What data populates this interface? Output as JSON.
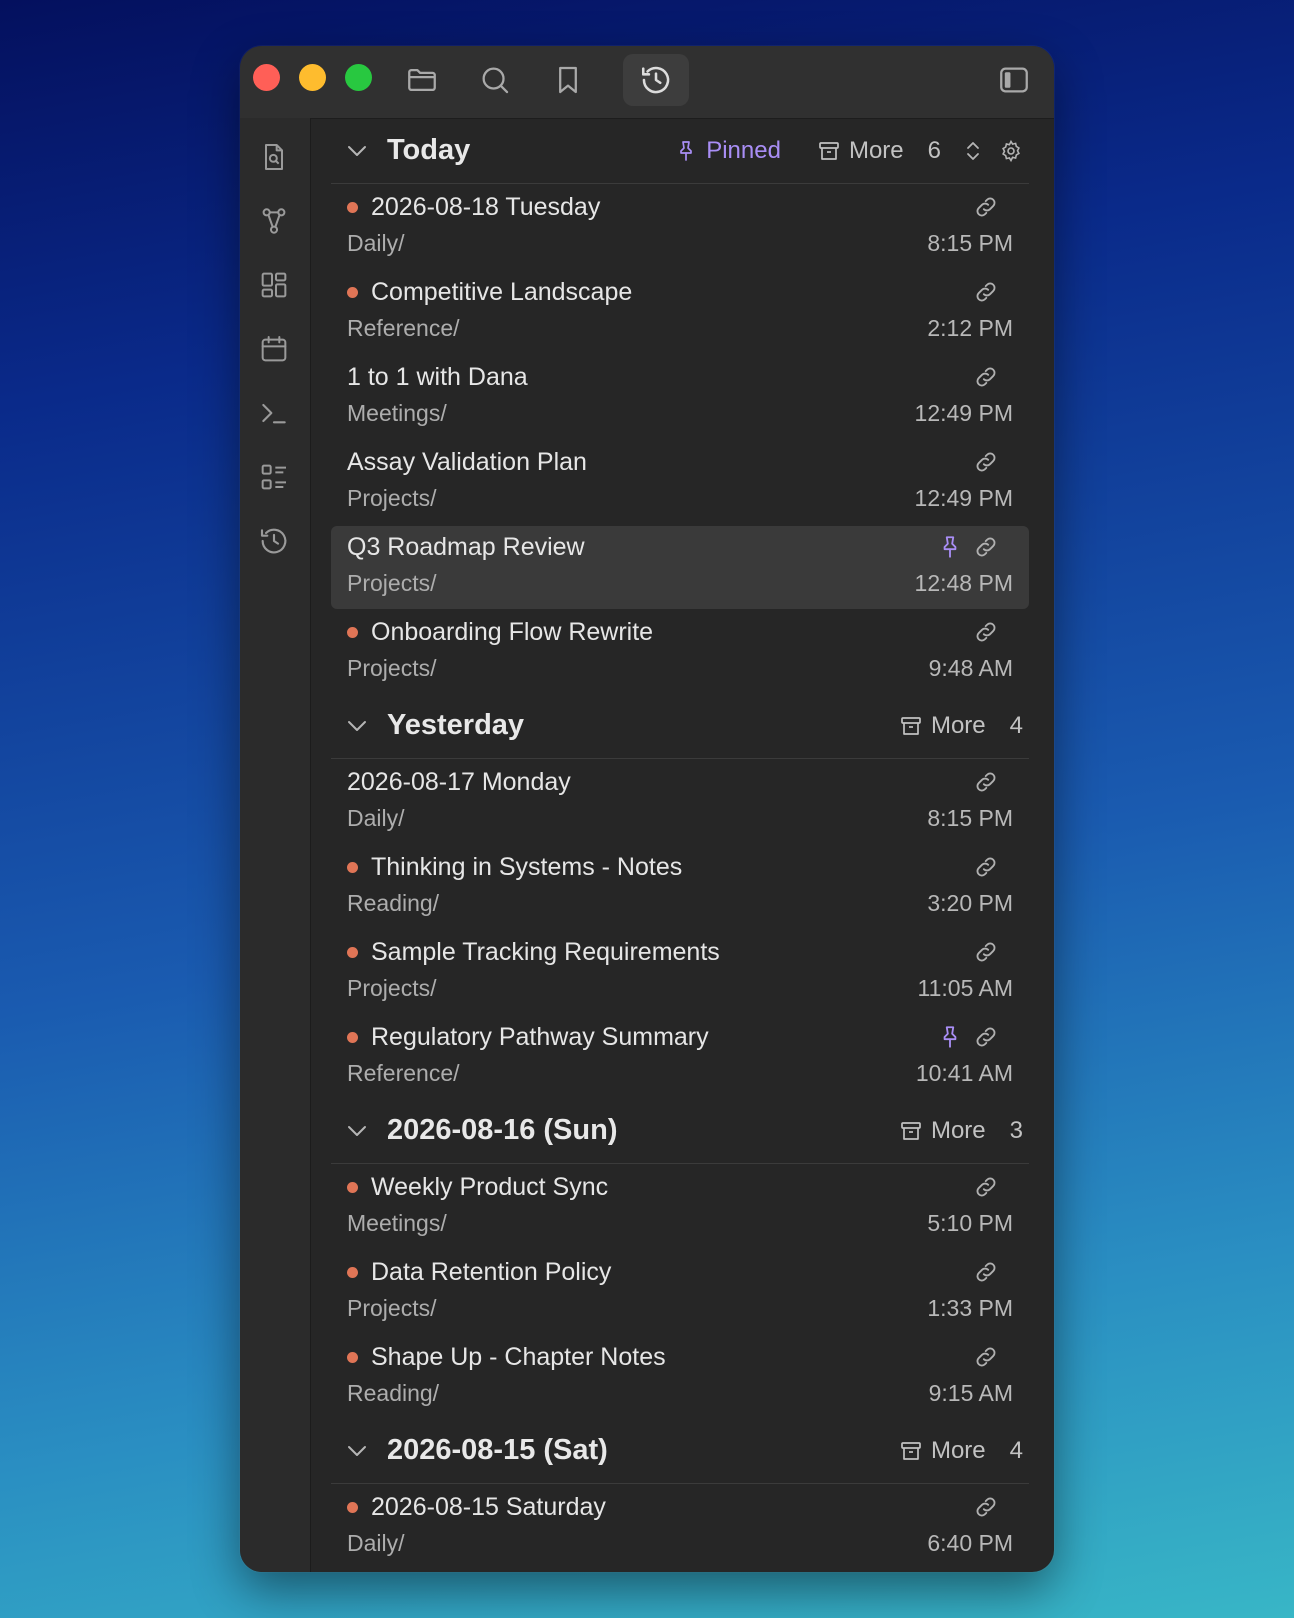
{
  "colors": {
    "accent_purple": "#a98ef5",
    "dot_orange": "#e07556",
    "traffic_red": "#ff5f57",
    "traffic_yellow": "#febc2e",
    "traffic_green": "#28c840"
  },
  "toolbar": {
    "icons": [
      "folder-icon",
      "search-icon",
      "bookmark-icon",
      "history-icon",
      "sidebar-toggle-icon"
    ],
    "active": "history-icon"
  },
  "ribbon": {
    "icons": [
      "file-search-icon",
      "graph-icon",
      "dashboard-icon",
      "calendar-icon",
      "terminal-icon",
      "checklist-icon",
      "history-icon"
    ]
  },
  "sections": [
    {
      "title": "Today",
      "pinned_label": "Pinned",
      "more_label": "More",
      "count": "6",
      "items": [
        {
          "title": "2026-08-18 Tuesday",
          "folder": "Daily/",
          "time": "8:15 PM",
          "dot": true,
          "pinned": false
        },
        {
          "title": "Competitive Landscape",
          "folder": "Reference/",
          "time": "2:12 PM",
          "dot": true,
          "pinned": false
        },
        {
          "title": "1 to 1 with Dana",
          "folder": "Meetings/",
          "time": "12:49 PM",
          "dot": false,
          "pinned": false
        },
        {
          "title": "Assay Validation Plan",
          "folder": "Projects/",
          "time": "12:49 PM",
          "dot": false,
          "pinned": false
        },
        {
          "title": "Q3 Roadmap Review",
          "folder": "Projects/",
          "time": "12:48 PM",
          "dot": false,
          "pinned": true,
          "selected": true
        },
        {
          "title": "Onboarding Flow Rewrite",
          "folder": "Projects/",
          "time": "9:48 AM",
          "dot": true,
          "pinned": false
        }
      ]
    },
    {
      "title": "Yesterday",
      "more_label": "More",
      "count": "4",
      "items": [
        {
          "title": "2026-08-17 Monday",
          "folder": "Daily/",
          "time": "8:15 PM",
          "dot": false,
          "pinned": false
        },
        {
          "title": "Thinking in Systems - Notes",
          "folder": "Reading/",
          "time": "3:20 PM",
          "dot": true,
          "pinned": false
        },
        {
          "title": "Sample Tracking Requirements",
          "folder": "Projects/",
          "time": "11:05 AM",
          "dot": true,
          "pinned": false
        },
        {
          "title": "Regulatory Pathway Summary",
          "folder": "Reference/",
          "time": "10:41 AM",
          "dot": true,
          "pinned": true
        }
      ]
    },
    {
      "title": "2026-08-16 (Sun)",
      "more_label": "More",
      "count": "3",
      "items": [
        {
          "title": "Weekly Product Sync",
          "folder": "Meetings/",
          "time": "5:10 PM",
          "dot": true,
          "pinned": false
        },
        {
          "title": "Data Retention Policy",
          "folder": "Projects/",
          "time": "1:33 PM",
          "dot": true,
          "pinned": false
        },
        {
          "title": "Shape Up - Chapter Notes",
          "folder": "Reading/",
          "time": "9:15 AM",
          "dot": true,
          "pinned": false
        }
      ]
    },
    {
      "title": "2026-08-15 (Sat)",
      "more_label": "More",
      "count": "4",
      "items": [
        {
          "title": "2026-08-15 Saturday",
          "folder": "Daily/",
          "time": "6:40 PM",
          "dot": true,
          "pinned": false
        }
      ]
    }
  ]
}
